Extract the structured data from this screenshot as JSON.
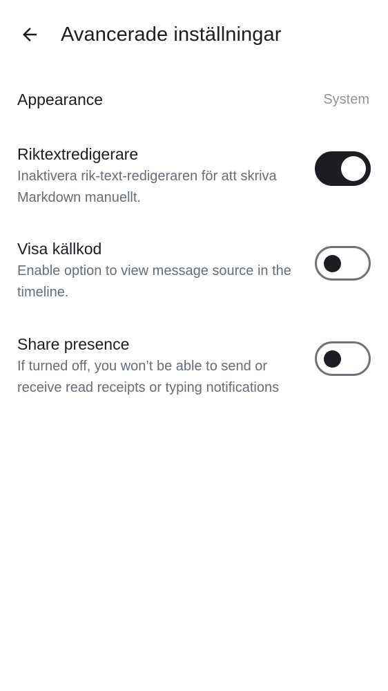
{
  "header": {
    "back_icon": "arrow-left-icon",
    "title": "Avancerade inställningar"
  },
  "settings": [
    {
      "title": "Appearance",
      "value": "System"
    },
    {
      "title": "Riktextredigerare",
      "description": "Inaktivera rik-text-redigeraren för att skriva Markdown manuellt.",
      "enabled": true
    },
    {
      "title": "Visa källkod",
      "description": "Enable option to view message source in the timeline.",
      "enabled": false
    },
    {
      "title": "Share presence",
      "description": "If turned off, you won’t be able to send or receive read receipts or typing notifications",
      "enabled": false
    }
  ],
  "colors": {
    "text_primary": "#1b1d22",
    "text_secondary": "#656d77",
    "switch_on": "#1b1d22",
    "switch_off_border": "#6d747c"
  }
}
